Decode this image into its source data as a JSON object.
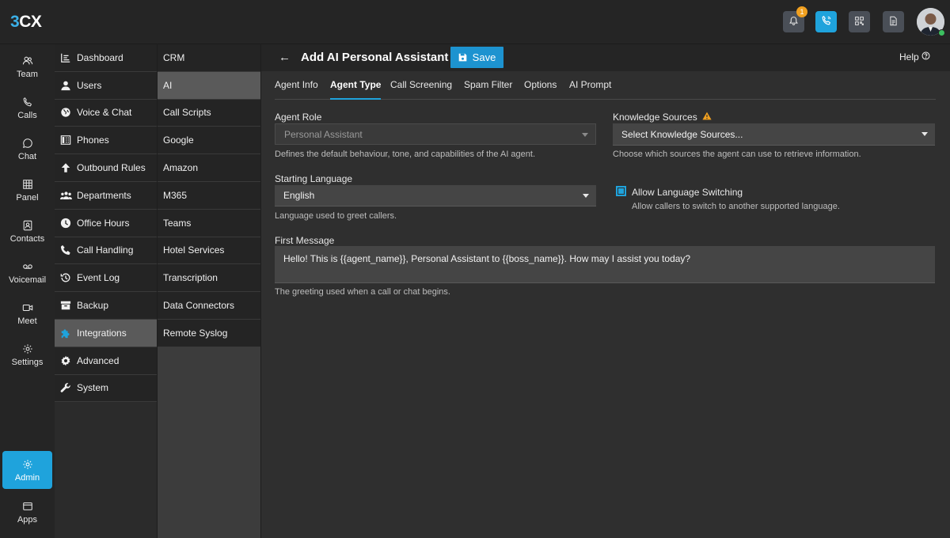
{
  "topbar": {
    "logo": {
      "part1": "3",
      "part2": "CX"
    },
    "notifications_count": "1",
    "icons": [
      "bell-icon",
      "phone-icon",
      "qr-code-icon",
      "document-icon"
    ]
  },
  "rail": {
    "items": [
      {
        "label": "Team",
        "icon": "team-icon"
      },
      {
        "label": "Calls",
        "icon": "phone-icon"
      },
      {
        "label": "Chat",
        "icon": "chat-icon"
      },
      {
        "label": "Panel",
        "icon": "grid-icon"
      },
      {
        "label": "Contacts",
        "icon": "contacts-icon"
      },
      {
        "label": "Voicemail",
        "icon": "voicemail-icon"
      },
      {
        "label": "Meet",
        "icon": "video-icon"
      },
      {
        "label": "Settings",
        "icon": "gear-icon"
      },
      {
        "label": "Admin",
        "icon": "admin-gear-icon"
      },
      {
        "label": "Apps",
        "icon": "apps-icon"
      }
    ]
  },
  "admin_menu": {
    "items": [
      {
        "label": "Dashboard"
      },
      {
        "label": "Users"
      },
      {
        "label": "Voice & Chat"
      },
      {
        "label": "Phones"
      },
      {
        "label": "Outbound Rules"
      },
      {
        "label": "Departments"
      },
      {
        "label": "Office Hours"
      },
      {
        "label": "Call Handling"
      },
      {
        "label": "Event Log"
      },
      {
        "label": "Backup"
      },
      {
        "label": "Integrations"
      },
      {
        "label": "Advanced"
      },
      {
        "label": "System"
      }
    ],
    "active": "Integrations"
  },
  "integrations_menu": {
    "items": [
      {
        "label": "CRM"
      },
      {
        "label": "AI"
      },
      {
        "label": "Call Scripts"
      },
      {
        "label": "Google"
      },
      {
        "label": "Amazon"
      },
      {
        "label": "M365"
      },
      {
        "label": "Teams"
      },
      {
        "label": "Hotel Services"
      },
      {
        "label": "Transcription"
      },
      {
        "label": "Data Connectors"
      },
      {
        "label": "Remote Syslog"
      }
    ],
    "active": "AI"
  },
  "header": {
    "back": "←",
    "title": "Add AI Personal Assistant",
    "save_label": "Save",
    "help_label": "Help"
  },
  "tabs": [
    {
      "label": "Agent Info"
    },
    {
      "label": "Agent Type"
    },
    {
      "label": "Call Screening"
    },
    {
      "label": "Spam Filter"
    },
    {
      "label": "Options"
    },
    {
      "label": "AI Prompt"
    }
  ],
  "active_tab": "Agent Type",
  "form": {
    "agent_role": {
      "label": "Agent Role",
      "value": "Personal Assistant",
      "help": "Defines the default behaviour, tone, and capabilities of the AI agent."
    },
    "knowledge_sources": {
      "label": "Knowledge Sources",
      "value": "Select Knowledge Sources...",
      "help": "Choose which sources the agent can use to retrieve information.",
      "warning_color": "#f0a020"
    },
    "starting_language": {
      "label": "Starting Language",
      "value": "English",
      "help": "Language used to greet callers."
    },
    "allow_language_switching": {
      "label": "Allow Language Switching",
      "help": "Allow callers to switch to another supported language.",
      "checked": true
    },
    "first_message": {
      "label": "First Message",
      "value": "Hello! This is {{agent_name}}, Personal Assistant to {{boss_name}}. How may I assist you today?",
      "help": "The greeting used when a call or chat begins."
    }
  },
  "colors": {
    "accent": "#1fa3dc",
    "save_button": "#1d93d0",
    "badge": "#f0a020",
    "presence": "#3cc060"
  }
}
